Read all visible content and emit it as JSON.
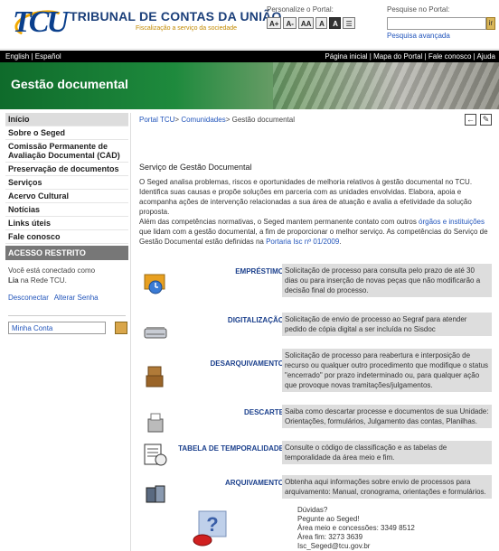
{
  "header": {
    "org_name": "TRIBUNAL DE CONTAS DA UNIÃO",
    "org_subtitle": "Fiscalização a serviço da sociedade",
    "personalize_label": "Personalize o Portal:",
    "font_buttons": [
      "A+",
      "A-",
      "AA",
      "A",
      "A",
      "☰"
    ],
    "search_label": "Pesquise no Portal:",
    "search_placeholder": "",
    "search_go": "ir",
    "advanced_search": "Pesquisa avançada"
  },
  "topnav": {
    "languages": "English | Español",
    "links": "Página inicial | Mapa do Portal | Fale conosco | Ajuda"
  },
  "banner": {
    "title": "Gestão documental"
  },
  "sidebar": {
    "menu": [
      "Início",
      "Sobre o Seged",
      "Comissão Permanente de Avaliação Documental (CAD)",
      "Preservação de documentos",
      "Serviços",
      "Acervo Cultural",
      "Notícias",
      "Links úteis",
      "Fale conosco"
    ],
    "restricted_title": "ACESSO RESTRITO",
    "connected_text": "Você está conectado como",
    "user": "Lia",
    "network_text": "na Rede TCU.",
    "disconnect": "Desconectar",
    "change_password": "Alterar Senha",
    "account_value": "Minha Conta"
  },
  "main": {
    "breadcrumb": {
      "portal": "Portal TCU",
      "sep1": ">",
      "communities": "Comunidades",
      "sep2": ">",
      "current": "Gestão documental"
    },
    "section_title": "Serviço de Gestão Documental",
    "intro_p1": "O Seged analisa problemas, riscos e oportunidades de melhoria relativos à gestão documental no TCU. Identifica suas causas e propõe soluções em parceria com as unidades envolvidas. Elabora, apoia e acompanha ações de intervenção relacionadas a sua área de atuação e avalia a efetividade da solução proposta.",
    "intro_p2_a": "Além das competências normativas, o Seged mantem permanente contato com outros ",
    "intro_p2_link": "órgãos e instituições",
    "intro_p2_b": " que lidam com a gestão documental, a fim de proporcionar o melhor serviço. As competências do Serviço de Gestão Documental estão definidas na ",
    "intro_p2_link2": "Portaria Isc nº 01/2009",
    "intro_p2_c": ".",
    "services": [
      {
        "icon": "clock-folder-icon",
        "label": "EMPRÉSTIMO",
        "desc": "Solicitação de processo para consulta pelo prazo de até 30 dias ou para inserção de novas peças que não modificarão a decisão final do processo."
      },
      {
        "icon": "scanner-icon",
        "label": "DIGITALIZAÇÃO",
        "desc": "Solicitação de envio de processo ao Segraf para atender pedido de cópia digital a ser incluída no Sisdoc"
      },
      {
        "icon": "boxes-icon",
        "label": "DESARQUIVAMENTO",
        "desc": "Solicitação de processo para reabertura e interposição de recurso ou qualquer outro procedimento que modifique o status \"encerrado\" por prazo indeterminado ou, para qualquer ação que provoque novas tramitações/julgamentos."
      },
      {
        "icon": "shredder-icon",
        "label": "DESCARTE",
        "desc": "Saiba como descartar processe e documentos de sua Unidade: Orientações, formulários, Julgamento das contas, Planilhas."
      },
      {
        "icon": "table-clock-icon",
        "label": "TABELA DE TEMPORALIDADE",
        "desc": "Consulte o código de classificação e as tabelas de temporalidade da área meio e fim."
      },
      {
        "icon": "archive-icon",
        "label": "ARQUIVAMENTO",
        "desc": "Obtenha aqui informações sobre envio de processos para arquivamento: Manual, cronograma, orientações e formulários."
      }
    ],
    "help": {
      "line1": "Dúvidas?",
      "line2": "Pegunte ao Seged!",
      "line3": "Área meio e concessões: 3349 8512",
      "line4": "Área fim: 3273 3639",
      "line5": "Isc_Seged@tcu.gov.br"
    }
  }
}
